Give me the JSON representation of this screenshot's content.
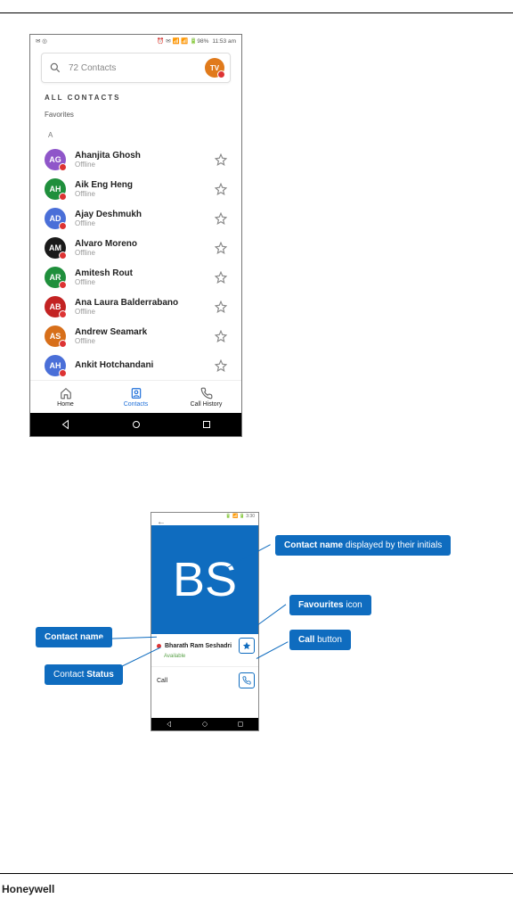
{
  "footer_brand": "Honeywell",
  "phone1": {
    "status_time": "11:53 am",
    "status_indicators": "⏰ ✉  ⚡ 📶 📶 🔋 98%",
    "search_placeholder": "72 Contacts",
    "avatar_initials": "TV",
    "section_title": "ALL CONTACTS",
    "favorites_label": "Favorites",
    "index_letter": "A",
    "contacts": [
      {
        "initials": "AG",
        "name": "Ahanjita Ghosh",
        "status": "Offline",
        "color": "#8f56c9"
      },
      {
        "initials": "AH",
        "name": "Aik Eng Heng",
        "status": "Offline",
        "color": "#1f8f3c"
      },
      {
        "initials": "AD",
        "name": "Ajay Deshmukh",
        "status": "Offline",
        "color": "#4a6fd8"
      },
      {
        "initials": "AM",
        "name": "Alvaro Moreno",
        "status": "Offline",
        "color": "#1a1a1a"
      },
      {
        "initials": "AR",
        "name": "Amitesh Rout",
        "status": "Offline",
        "color": "#1f8f3c"
      },
      {
        "initials": "AB",
        "name": "Ana Laura Balderrabano",
        "status": "Offline",
        "color": "#c32323"
      },
      {
        "initials": "AS",
        "name": "Andrew Seamark",
        "status": "Offline",
        "color": "#d76f1a"
      },
      {
        "initials": "AH",
        "name": "Ankit Hotchandani",
        "status": "",
        "color": "#4a6fd8"
      }
    ],
    "nav": {
      "home": "Home",
      "contacts": "Contacts",
      "history": "Call History"
    }
  },
  "phone2": {
    "hero_initials": "BS",
    "contact_name": "Bharath Ram Seshadri",
    "contact_status": "Available",
    "call_label": "Call"
  },
  "callouts": {
    "contact_name_label": "Contact name",
    "contact_status_pre": "Contact ",
    "contact_status_bold": "Status",
    "initials_bold": "Contact name",
    "initials_rest": " displayed by their initials",
    "fav_bold": "Favourites",
    "fav_rest": " icon",
    "call_bold": "Call",
    "call_rest": " button"
  }
}
